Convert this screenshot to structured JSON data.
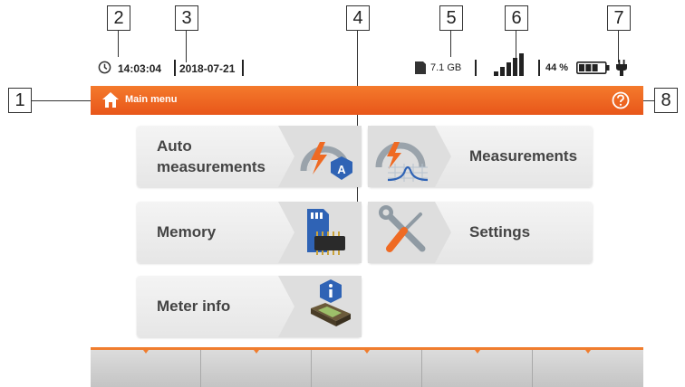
{
  "callouts": [
    "1",
    "2",
    "3",
    "4",
    "5",
    "6",
    "7",
    "8"
  ],
  "status": {
    "time": "14:03:04",
    "date": "2018-07-21",
    "storage": "7.1 GB",
    "battery_percent": "44 %",
    "signal_level": 5,
    "battery_level": 0.75
  },
  "title_bar": {
    "title": "Main menu"
  },
  "tiles": {
    "auto_measurements": {
      "line1": "Auto",
      "line2": "measurements"
    },
    "measurements": "Measurements",
    "memory": "Memory",
    "settings": "Settings",
    "meter_info": "Meter info"
  },
  "colors": {
    "accent": "#ef6a23",
    "tile_bg": "#ededed",
    "fkey_bg": "#d0d0d0"
  }
}
